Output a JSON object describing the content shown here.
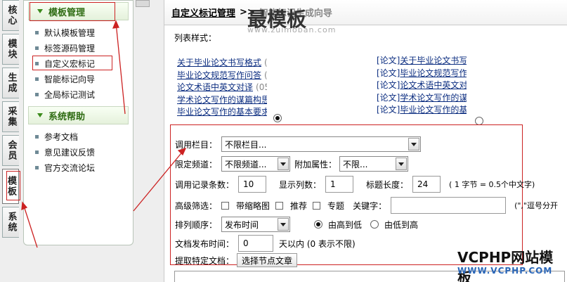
{
  "vtabs": [
    "核心",
    "模块",
    "生成",
    "采集",
    "会员",
    "模板",
    "系统"
  ],
  "menu": {
    "group1": {
      "title": "模板管理",
      "items": [
        "默认模板管理",
        "标签源码管理",
        "自定义宏标记",
        "智能标记向导",
        "全局标记测试"
      ]
    },
    "group2": {
      "title": "系统帮助",
      "items": [
        "参考文档",
        "意见建议反馈",
        "官方交流论坛"
      ]
    }
  },
  "breadcrumb": {
    "root": "自定义标记管理",
    "sep": ">>",
    "current": "智能标记生成向导"
  },
  "watermark": {
    "title": "最模板",
    "url": "www.zuimoban.com"
  },
  "list_style_label": "列表样式：",
  "demo_left": [
    {
      "text": "关于毕业论文书写格式",
      "num": "("
    },
    {
      "text": "毕业论文规范写作问答",
      "num": "("
    },
    {
      "text": "论文术语中英文对译",
      "num": "(05"
    },
    {
      "text": "学术论文写作的谋篇构思",
      "num": ""
    },
    {
      "text": "毕业论文写作的基本要求",
      "num": ""
    }
  ],
  "demo_right": [
    {
      "cat": "[论文]",
      "text": "关于毕业论文书写格"
    },
    {
      "cat": "[论文]",
      "text": "毕业论文规范写作问"
    },
    {
      "cat": "[论文]",
      "text": "论文术语中英文对译"
    },
    {
      "cat": "[论文]",
      "text": "学术论文写作的谋篇"
    },
    {
      "cat": "[论文]",
      "text": "毕业论文写作的基本"
    }
  ],
  "form": {
    "column_label": "调用栏目：",
    "column_value": "不限栏目...",
    "channel_label": "限定频道：",
    "channel_value": "不限频道...",
    "attr_label": "附加属性：",
    "attr_value": "不限...",
    "count_label": "调用记录条数：",
    "count_value": "10",
    "cols_label": "显示列数：",
    "cols_value": "1",
    "titlelen_label": "标题长度：",
    "titlelen_value": "24",
    "titlelen_hint": "( 1 字节 = 0.5个中文字)",
    "filter_label": "高级筛选：",
    "filter_thumb": "带缩略图",
    "filter_recommend": "推荐",
    "filter_topic": "专题",
    "keyword_label": "关键字：",
    "keyword_hint": "(\",\"逗号分开",
    "order_label": "排列顺序：",
    "order_value": "发布时间",
    "order_desc": "由高到低",
    "order_asc": "由低到高",
    "days_label": "文档发布时间：",
    "days_value": "0",
    "days_hint": "天以内 (0 表示不限)",
    "node_label": "提取特定文档：",
    "node_button": "选择节点文章"
  },
  "brand": {
    "name": "VCPHP网站模板",
    "url": "WWW.VCPHP.COM"
  },
  "colors": {
    "annotation_red": "#cc2222",
    "menu_green": "#2e6b12",
    "link_blue": "#0b2d80"
  }
}
